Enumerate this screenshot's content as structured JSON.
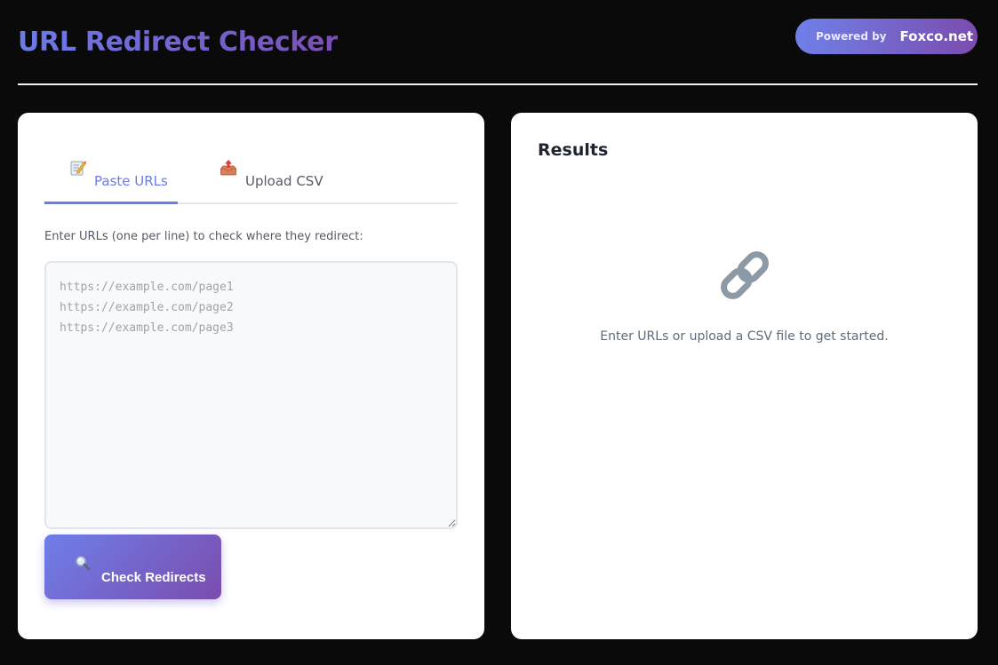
{
  "header": {
    "title": "URL Redirect Checker",
    "powered_label": "Powered by",
    "powered_brand": "Foxco.net"
  },
  "input_panel": {
    "tabs": [
      {
        "label": "Paste URLs",
        "icon": "memo-icon",
        "active": true
      },
      {
        "label": "Upload CSV",
        "icon": "upload-tray-icon",
        "active": false
      }
    ],
    "instructions": "Enter URLs (one per line) to check where they redirect:",
    "textarea": {
      "value": "",
      "placeholder": "https://example.com/page1\nhttps://example.com/page2\nhttps://example.com/page3"
    },
    "check_button": {
      "label": "Check Redirects",
      "icon": "magnifier-icon"
    }
  },
  "results_panel": {
    "title": "Results",
    "empty_icon": "link-icon",
    "empty_message": "Enter URLs or upload a CSV file to get started."
  },
  "colors": {
    "background": "#0a0a0a",
    "accent_start": "#6c7bea",
    "accent_end": "#7b4cae",
    "panel": "#ffffff"
  }
}
